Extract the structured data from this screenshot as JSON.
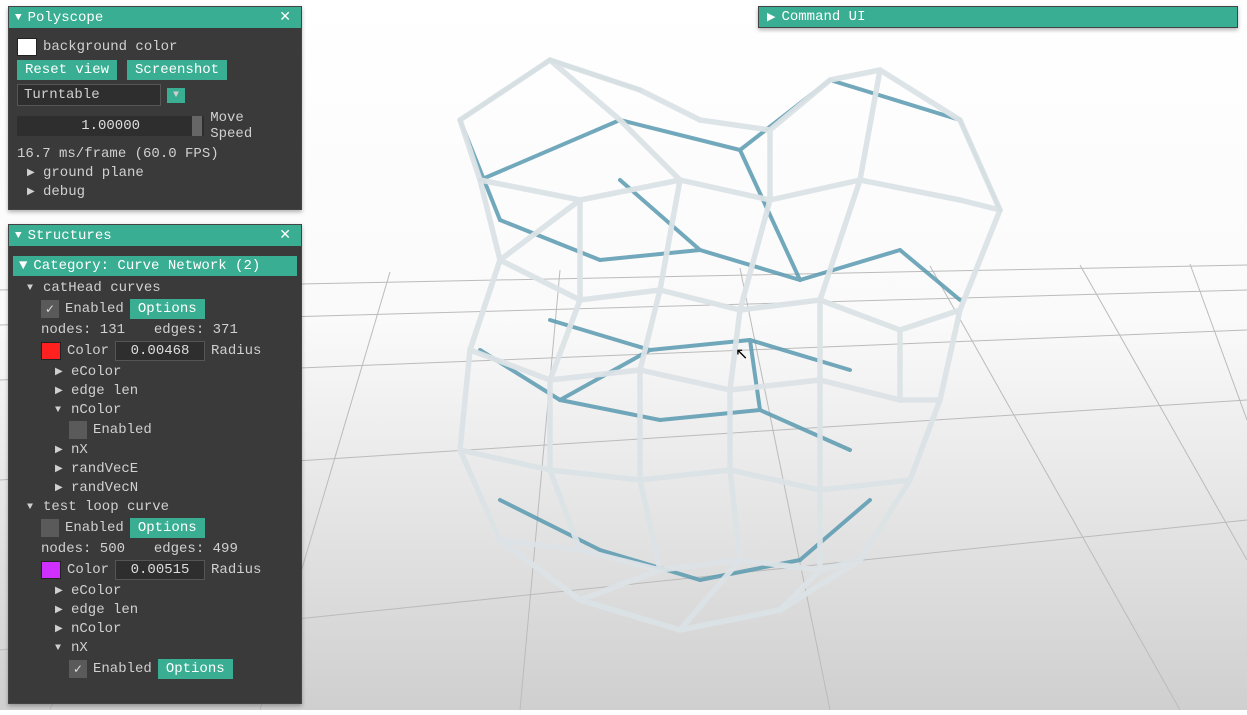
{
  "polyscope_panel": {
    "title": "Polyscope",
    "bg_color_label": "background color",
    "reset_view": "Reset view",
    "screenshot": "Screenshot",
    "nav_mode": "Turntable",
    "move_speed_value": "1.00000",
    "move_speed_label": "Move Speed",
    "frame_stats": "16.7 ms/frame (60.0 FPS)",
    "ground_plane": "ground plane",
    "debug": "debug"
  },
  "command_panel": {
    "title": "Command UI"
  },
  "structures_panel": {
    "title": "Structures",
    "category": "Category: Curve Network (2)",
    "items": [
      {
        "name": "catHead curves",
        "enabled_label": "Enabled",
        "options_label": "Options",
        "enabled": true,
        "nodes": "nodes: 131",
        "edges": "edges: 371",
        "color_label": "Color",
        "radius_value": "0.00468",
        "radius_label": "Radius",
        "color_swatch_class": "red",
        "subs": [
          {
            "label": "eColor",
            "expanded": false
          },
          {
            "label": "edge len",
            "expanded": false
          },
          {
            "label": "nColor",
            "expanded": true,
            "child": {
              "enabled_label": "Enabled",
              "enabled": false
            }
          },
          {
            "label": "nX",
            "expanded": false
          },
          {
            "label": "randVecE",
            "expanded": false
          },
          {
            "label": "randVecN",
            "expanded": false
          }
        ]
      },
      {
        "name": "test loop curve",
        "enabled_label": "Enabled",
        "options_label": "Options",
        "enabled": false,
        "nodes": "nodes: 500",
        "edges": "edges: 499",
        "color_label": "Color",
        "radius_value": "0.00515",
        "radius_label": "Radius",
        "color_swatch_class": "magenta",
        "subs": [
          {
            "label": "eColor",
            "expanded": false
          },
          {
            "label": "edge len",
            "expanded": false
          },
          {
            "label": "nColor",
            "expanded": false
          },
          {
            "label": "nX",
            "expanded": true,
            "child": {
              "enabled_label": "Enabled",
              "enabled": true,
              "options_label": "Options"
            }
          }
        ]
      }
    ]
  }
}
